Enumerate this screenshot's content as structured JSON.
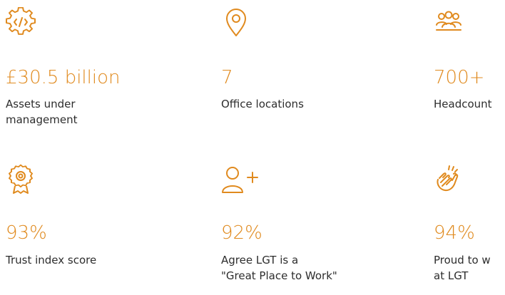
{
  "accent_color": "#e08a1e",
  "stats": [
    {
      "icon": "code-gear-icon",
      "value": "£30.5 billion",
      "label": "Assets under\nmanagement"
    },
    {
      "icon": "location-pin-icon",
      "value": "7",
      "label": "Office locations"
    },
    {
      "icon": "people-group-icon",
      "value": "700+",
      "label": "Headcount"
    },
    {
      "icon": "award-badge-icon",
      "value": "93%",
      "label": "Trust index score"
    },
    {
      "icon": "add-person-icon",
      "value": "92%",
      "label": "Agree LGT is a\n\"Great Place to Work\""
    },
    {
      "icon": "clapping-hands-icon",
      "value": "94%",
      "label": "Proud to w\nat LGT"
    }
  ]
}
